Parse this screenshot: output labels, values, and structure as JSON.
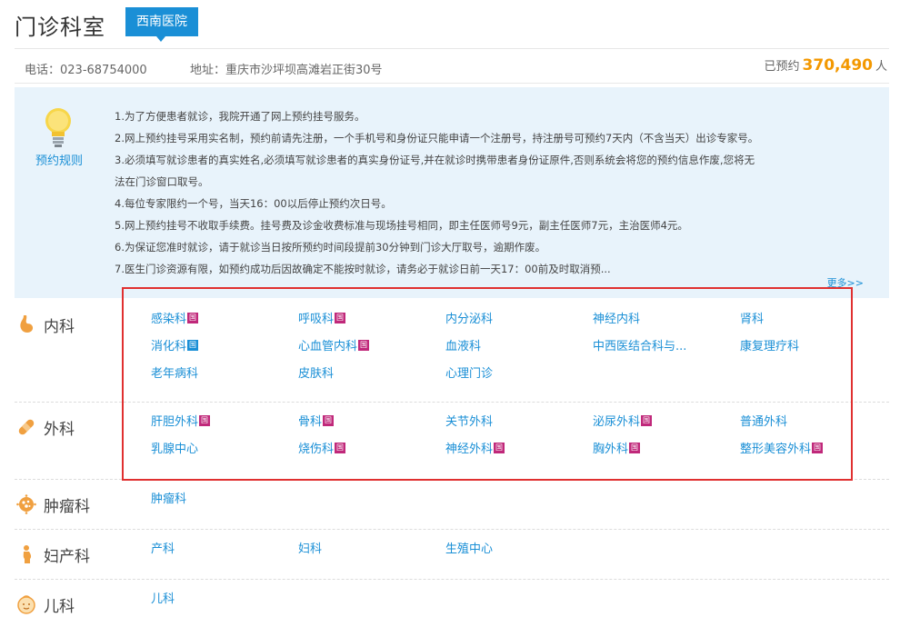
{
  "header": {
    "title": "门诊科室",
    "hospital_tag": "西南医院"
  },
  "info": {
    "phone": "电话：023-68754000",
    "address": "地址：重庆市沙坪坝高滩岩正街30号",
    "count_label": "已预约",
    "count": "370,490",
    "count_unit": "人"
  },
  "rules": {
    "title": "预约规则",
    "lines": [
      "1.为了方便患者就诊，我院开通了网上预约挂号服务。",
      "2.网上预约挂号采用实名制，预约前请先注册，一个手机号和身份证只能申请一个注册号，持注册号可预约7天内（不含当天）出诊专家号。",
      "3.必须填写就诊患者的真实姓名,必须填写就诊患者的真实身份证号,并在就诊时携带患者身份证原件,否则系统会将您的预约信息作废,您将无",
      "法在门诊窗口取号。",
      "4.每位专家限约一个号，当天16：00以后停止预约次日号。",
      "5.网上预约挂号不收取手续费。挂号费及诊金收费标准与现场挂号相同，即主任医师号9元，副主任医师7元，主治医师4元。",
      "6.为保证您准时就诊，请于就诊当日按所预约时间段提前30分钟到门诊大厅取号，逾期作废。",
      "7.医生门诊资源有限，如预约成功后因故确定不能按时就诊，请务必于就诊日前一天17：00前及时取消预..."
    ],
    "more": "更多>>"
  },
  "badge_text": "国",
  "departments": [
    {
      "label": "内科",
      "icon": "stomach-icon",
      "items": [
        {
          "name": "感染科",
          "badge": "red"
        },
        {
          "name": "呼吸科",
          "badge": "red"
        },
        {
          "name": "内分泌科",
          "badge": ""
        },
        {
          "name": "神经内科",
          "badge": ""
        },
        {
          "name": "肾科",
          "badge": ""
        },
        {
          "name": "消化科",
          "badge": "blue"
        },
        {
          "name": "心血管内科",
          "badge": "red"
        },
        {
          "name": "血液科",
          "badge": ""
        },
        {
          "name": "中西医结合科与...",
          "badge": ""
        },
        {
          "name": "康复理疗科",
          "badge": ""
        },
        {
          "name": "老年病科",
          "badge": ""
        },
        {
          "name": "皮肤科",
          "badge": ""
        },
        {
          "name": "心理门诊",
          "badge": ""
        }
      ]
    },
    {
      "label": "外科",
      "icon": "bandage-icon",
      "items": [
        {
          "name": "肝胆外科",
          "badge": "red"
        },
        {
          "name": "骨科",
          "badge": "red"
        },
        {
          "name": "关节外科",
          "badge": ""
        },
        {
          "name": "泌尿外科",
          "badge": "red"
        },
        {
          "name": "普通外科",
          "badge": ""
        },
        {
          "name": "乳腺中心",
          "badge": ""
        },
        {
          "name": "烧伤科",
          "badge": "red"
        },
        {
          "name": "神经外科",
          "badge": "red"
        },
        {
          "name": "胸外科",
          "badge": "red"
        },
        {
          "name": "整形美容外科",
          "badge": "red"
        }
      ]
    },
    {
      "label": "肿瘤科",
      "icon": "virus-icon",
      "items": [
        {
          "name": "肿瘤科",
          "badge": ""
        }
      ]
    },
    {
      "label": "妇产科",
      "icon": "pregnant-woman-icon",
      "items": [
        {
          "name": "产科",
          "badge": ""
        },
        {
          "name": "妇科",
          "badge": ""
        },
        {
          "name": "生殖中心",
          "badge": ""
        }
      ]
    },
    {
      "label": "儿科",
      "icon": "child-face-icon",
      "items": [
        {
          "name": "儿科",
          "badge": ""
        }
      ]
    }
  ],
  "colors": {
    "accent": "#1a8fd6",
    "count": "#f39800",
    "badge_red": "#c0287a",
    "highlight": "#e03030",
    "icon_orange": "#f0a040"
  }
}
